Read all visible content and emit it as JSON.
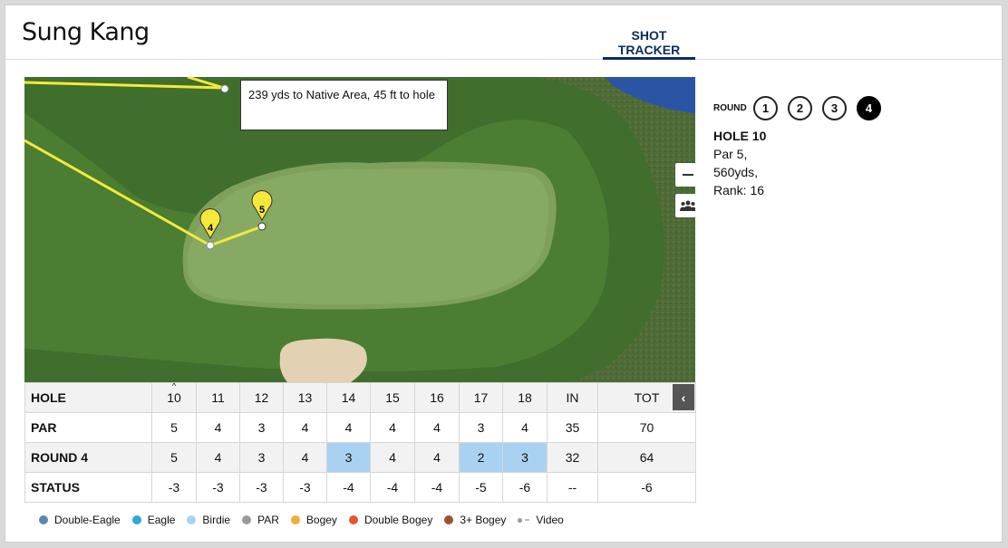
{
  "header": {
    "player_name": "Sung Kang",
    "tab_label": "SHOT TRACKER"
  },
  "map": {
    "tooltip": "239 yds to Native Area, 45 ft to hole",
    "markers": [
      {
        "label": "4"
      },
      {
        "label": "5"
      }
    ],
    "controls": {
      "zoom_out": "zoom-out-icon",
      "group": "group-icon"
    }
  },
  "round_selector": {
    "label": "ROUND",
    "rounds": [
      "1",
      "2",
      "3",
      "4"
    ],
    "active": "4"
  },
  "hole": {
    "title": "HOLE 10",
    "par": "Par 5,",
    "yards": "560yds,",
    "rank": "Rank: 16"
  },
  "scorecard": {
    "headers": [
      "HOLE",
      "10",
      "11",
      "12",
      "13",
      "14",
      "15",
      "16",
      "17",
      "18",
      "IN",
      "TOT"
    ],
    "rows": [
      {
        "label": "PAR",
        "values": [
          "5",
          "4",
          "3",
          "4",
          "4",
          "4",
          "4",
          "3",
          "4",
          "35",
          "70"
        ]
      },
      {
        "label": "ROUND 4",
        "values": [
          "5",
          "4",
          "3",
          "4",
          "3",
          "4",
          "4",
          "2",
          "3",
          "32",
          "64"
        ]
      },
      {
        "label": "STATUS",
        "values": [
          "-3",
          "-3",
          "-3",
          "-3",
          "-4",
          "-4",
          "-4",
          "-5",
          "-6",
          "--",
          "-6"
        ]
      }
    ],
    "collapse_icon": "chevron-left-icon"
  },
  "legend": [
    {
      "label": "Double-Eagle",
      "color": "#5b87b5"
    },
    {
      "label": "Eagle",
      "color": "#2fa6dc"
    },
    {
      "label": "Birdie",
      "color": "#a9d2f2"
    },
    {
      "label": "PAR",
      "color": "#9a9a9a"
    },
    {
      "label": "Bogey",
      "color": "#f0ac3c"
    },
    {
      "label": "Double Bogey",
      "color": "#e4572e"
    },
    {
      "label": "3+ Bogey",
      "color": "#a0522d"
    },
    {
      "label": "Video",
      "color": "#999999"
    }
  ],
  "colors": {
    "brand": "#0b2d5c",
    "birdie_cell": "#a9d2f2",
    "shot_line": "#f5e83b"
  }
}
